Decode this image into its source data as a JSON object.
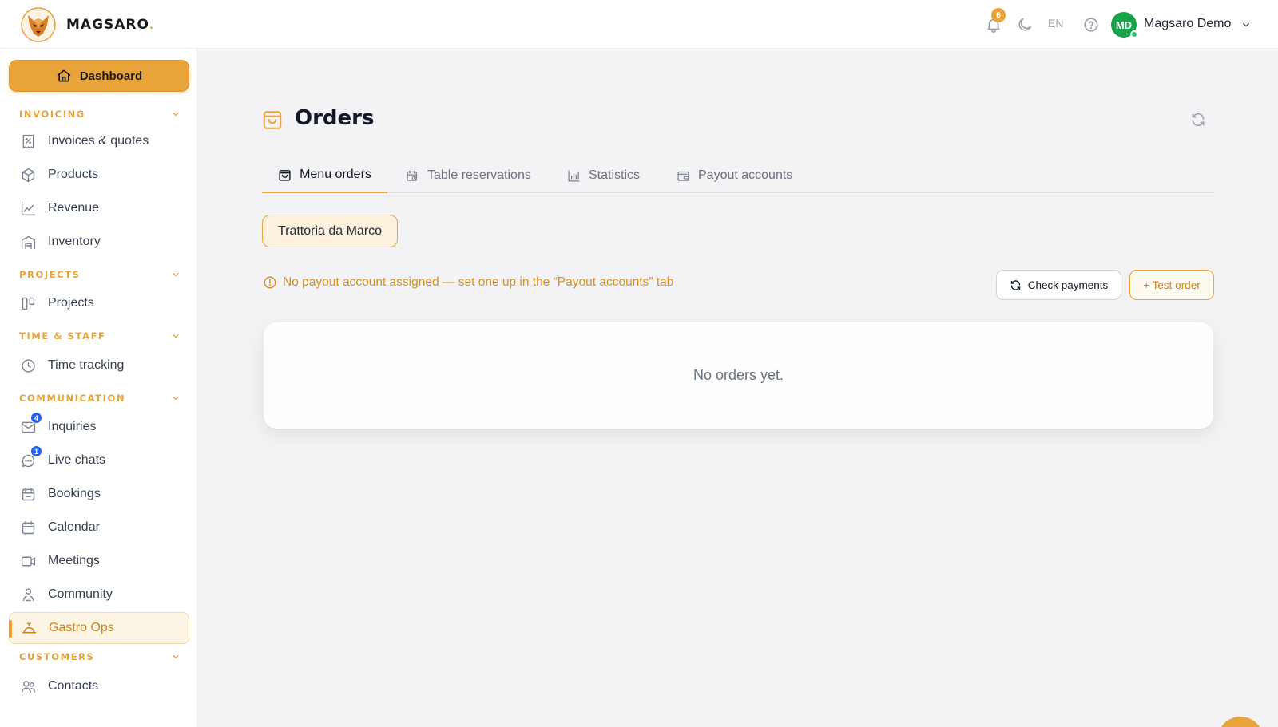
{
  "brand": {
    "name": "MAGSARO",
    "dot": "."
  },
  "topbar": {
    "notifications_count": "6",
    "language": "EN",
    "user_initials": "MD",
    "user_name": "Magsaro Demo"
  },
  "sidebar": {
    "dashboard_label": "Dashboard",
    "sections": {
      "invoicing": "INVOICING",
      "projects": "PROJECTS",
      "time_staff": "TIME & STAFF",
      "communication": "COMMUNICATION",
      "customers": "CUSTOMERS"
    },
    "items": {
      "invoices": "Invoices & quotes",
      "products": "Products",
      "revenue": "Revenue",
      "inventory": "Inventory",
      "projects": "Projects",
      "time_tracking": "Time tracking",
      "inquiries": "Inquiries",
      "live_chats": "Live chats",
      "bookings": "Bookings",
      "calendar": "Calendar",
      "meetings": "Meetings",
      "community": "Community",
      "gastro_ops": "Gastro Ops",
      "contacts": "Contacts"
    },
    "badges": {
      "inquiries": "4",
      "live_chats": "1"
    }
  },
  "main": {
    "title": "Orders",
    "tabs": {
      "menu_orders": "Menu orders",
      "table_reservations": "Table reservations",
      "statistics": "Statistics",
      "payout_accounts": "Payout accounts"
    },
    "venue": "Trattoria da Marco",
    "warning": "No payout account assigned — set one up in the “Payout accounts” tab",
    "check_payments": "Check payments",
    "test_order": "+ Test order",
    "empty_text": "No orders yet."
  },
  "colors": {
    "accent": "#e8a43a",
    "badge_blue": "#2563eb",
    "avatar_green": "#16a34a"
  }
}
